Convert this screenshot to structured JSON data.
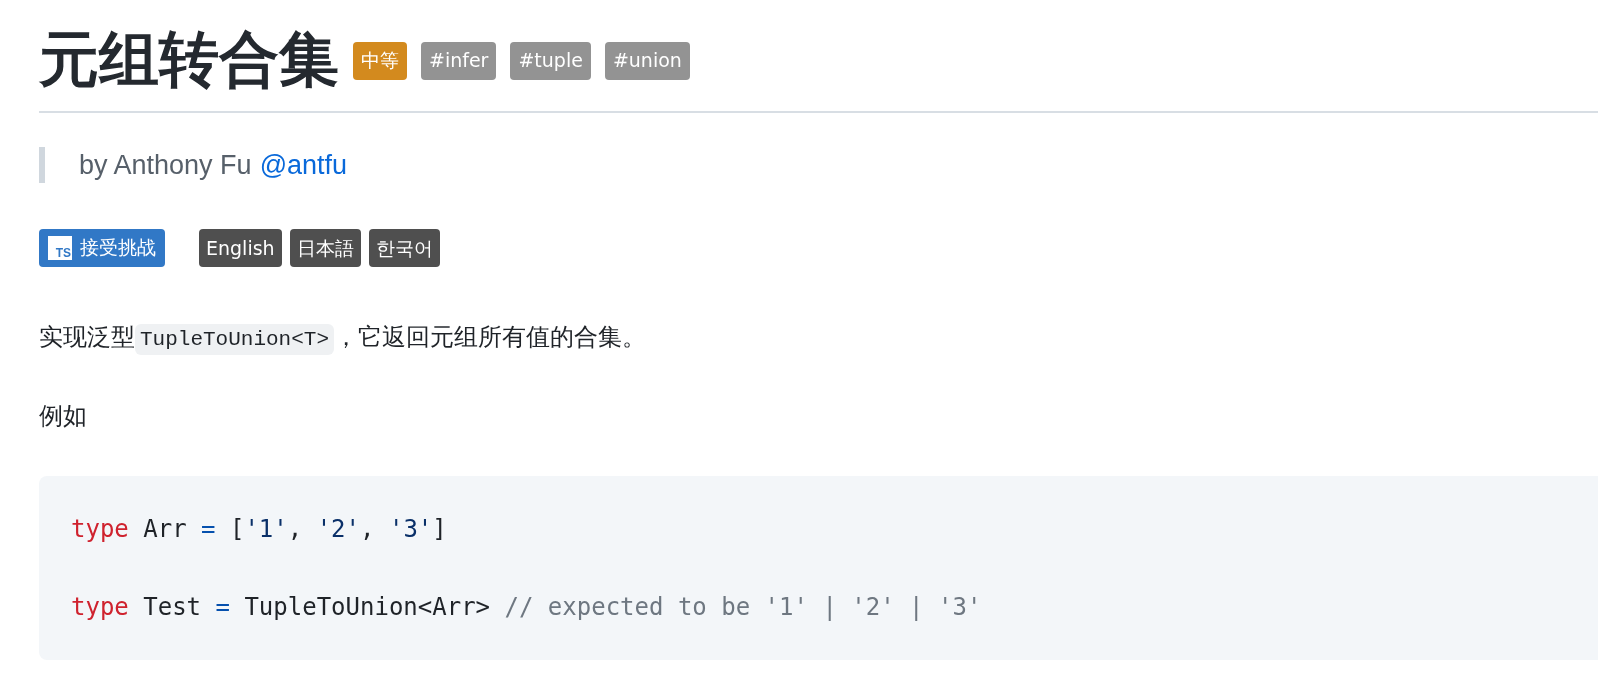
{
  "title": "元组转合集",
  "difficulty": {
    "label": "中等"
  },
  "tags": [
    "#infer",
    "#tuple",
    "#union"
  ],
  "author": {
    "text": "by Anthony Fu",
    "handle": "@antfu"
  },
  "actions": [
    {
      "kind": "ts",
      "icon_text": "TS",
      "label": "接受挑战"
    },
    {
      "kind": "lang",
      "label": "English"
    },
    {
      "kind": "lang",
      "label": "日本語"
    },
    {
      "kind": "lang",
      "label": "한국어"
    }
  ],
  "intro": {
    "before": "实现泛型",
    "code": "TupleToUnion<T>",
    "after": "，它返回元组所有值的合集。"
  },
  "example_label": "例如",
  "code_lines": [
    [
      {
        "kind": "keyword",
        "text": "type"
      },
      {
        "kind": "plain",
        "text": " Arr "
      },
      {
        "kind": "operator",
        "text": "="
      },
      {
        "kind": "plain",
        "text": " ["
      },
      {
        "kind": "string",
        "text": "'1'"
      },
      {
        "kind": "plain",
        "text": ", "
      },
      {
        "kind": "string",
        "text": "'2'"
      },
      {
        "kind": "plain",
        "text": ", "
      },
      {
        "kind": "string",
        "text": "'3'"
      },
      {
        "kind": "plain",
        "text": "]"
      }
    ],
    [
      {
        "kind": "keyword",
        "text": "type"
      },
      {
        "kind": "plain",
        "text": " Test "
      },
      {
        "kind": "operator",
        "text": "="
      },
      {
        "kind": "plain",
        "text": " TupleToUnion<Arr> "
      },
      {
        "kind": "comment",
        "text": "// expected to be '1' | '2' | '3'"
      }
    ]
  ]
}
